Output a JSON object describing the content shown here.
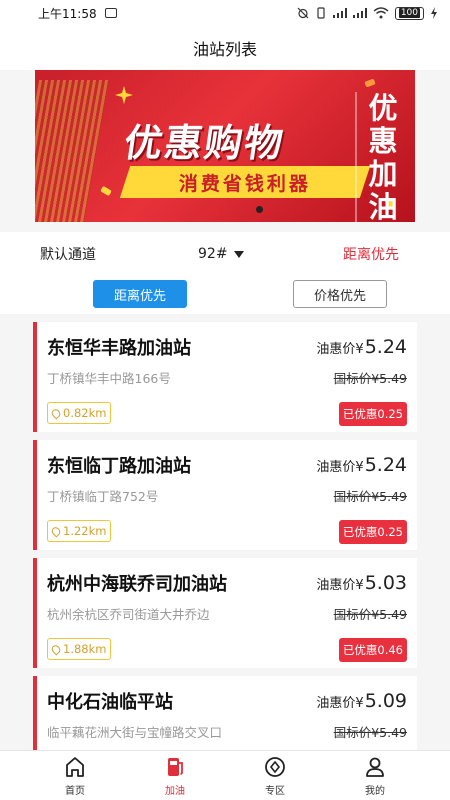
{
  "status_bar": {
    "time": "上午11:58",
    "battery": "100"
  },
  "header": {
    "title": "油站列表"
  },
  "banner": {
    "headline": "优惠购物",
    "vertical_text": "优惠加油",
    "ribbon_text": "消费省钱利器",
    "background_color": "#e8323a"
  },
  "filters": {
    "channel": "默认通道",
    "fuel_type": "92#",
    "sort": "距离优先"
  },
  "tabs": [
    {
      "label": "距离优先",
      "active": true
    },
    {
      "label": "价格优先",
      "active": false
    }
  ],
  "stations": [
    {
      "name": "东恒华丰路加油站",
      "address": "丁桥镇华丰中路166号",
      "distance": "0.82km",
      "price_label": "油惠价¥",
      "price": "5.24",
      "standard_price": "国标价¥5.49",
      "discount": "已优惠0.25"
    },
    {
      "name": "东恒临丁路加油站",
      "address": "丁桥镇临丁路752号",
      "distance": "1.22km",
      "price_label": "油惠价¥",
      "price": "5.24",
      "standard_price": "国标价¥5.49",
      "discount": "已优惠0.25"
    },
    {
      "name": "杭州中海联乔司加油站",
      "address": "杭州余杭区乔司街道大井乔边",
      "distance": "1.88km",
      "price_label": "油惠价¥",
      "price": "5.03",
      "standard_price": "国标价¥5.49",
      "discount": "已优惠0.46"
    },
    {
      "name": "中化石油临平站",
      "address": "临平藕花洲大街与宝幢路交叉口",
      "distance": "",
      "price_label": "油惠价¥",
      "price": "5.09",
      "standard_price": "国标价¥5.49",
      "discount": ""
    }
  ],
  "bottom_nav": [
    {
      "label": "首页",
      "icon": "home-icon",
      "active": false
    },
    {
      "label": "加油",
      "icon": "fuel-pump-icon",
      "active": true
    },
    {
      "label": "专区",
      "icon": "zone-icon",
      "active": false
    },
    {
      "label": "我的",
      "icon": "user-icon",
      "active": false
    }
  ],
  "colors": {
    "accent_red": "#e02e3b",
    "tab_blue": "#1e90e8",
    "distance_gold": "#d4a12a"
  }
}
